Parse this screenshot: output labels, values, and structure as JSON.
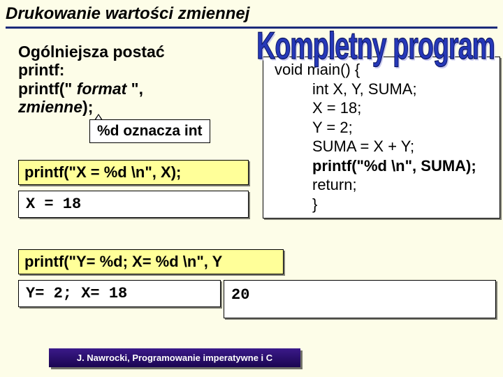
{
  "title": "Drukowanie wartości zmiennej",
  "wordart": "Kompletny program",
  "lead": {
    "l1": "Ogólniejsza postać",
    "l2a": "printf:",
    "l3a": "printf(\" ",
    "l3b": "format",
    "l3c": " \",",
    "l4a": "zmienne",
    "l4b": ");"
  },
  "callout": "%d oznacza int",
  "example1": {
    "code": "printf(\"X = %d \\n\", X);",
    "output": "X = 18"
  },
  "example2": {
    "code": "printf(\"Y= %d; X= %d \\n\", Y",
    "output": "Y= 2; X= 18"
  },
  "output3": "20",
  "program": {
    "l1": "void main() {",
    "l2": "int   X, Y, SUMA;",
    "l3": "X = 18;",
    "l4": "Y = 2;",
    "l5": "SUMA = X + Y;",
    "l6": "printf(\"%d \\n\",  SUMA);",
    "l7": "return;",
    "l8": "}"
  },
  "footer": "J. Nawrocki, Programowanie imperatywne i C"
}
